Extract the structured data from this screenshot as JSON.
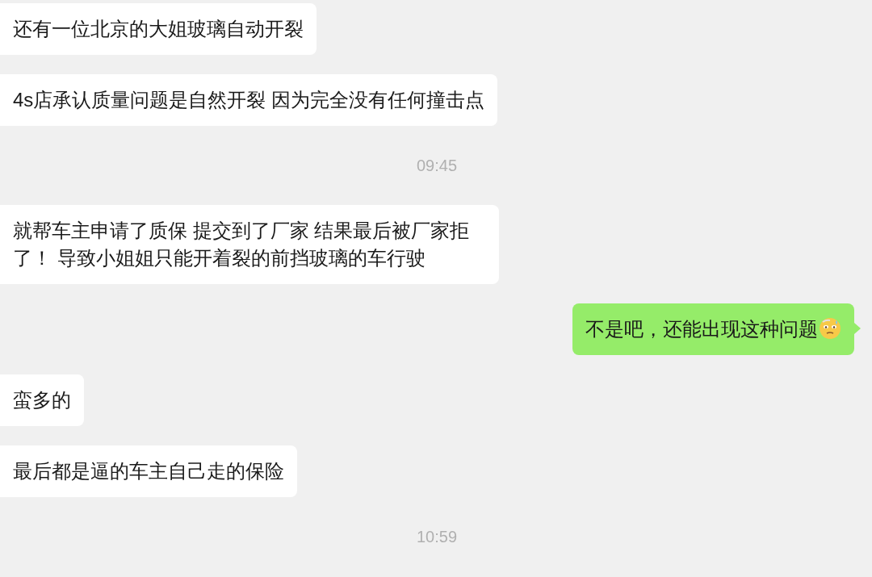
{
  "messages": [
    {
      "kind": "text",
      "outgoing": false,
      "text": "还有一位北京的大姐玻璃自动开裂"
    },
    {
      "kind": "text",
      "outgoing": false,
      "text": "4s店承认质量问题是自然开裂 因为完全没有任何撞击点"
    },
    {
      "kind": "time",
      "text": "09:45"
    },
    {
      "kind": "text",
      "outgoing": false,
      "text": "就帮车主申请了质保 提交到了厂家 结果最后被厂家拒了！ 导致小姐姐只能开着裂的前挡玻璃的车行驶"
    },
    {
      "kind": "text",
      "outgoing": true,
      "text": "不是吧，还能出现这种问题",
      "emoji": true
    },
    {
      "kind": "text",
      "outgoing": false,
      "text": "蛮多的"
    },
    {
      "kind": "text",
      "outgoing": false,
      "text": "最后都是逼的车主自己走的保险"
    },
    {
      "kind": "time",
      "text": "10:59"
    }
  ]
}
